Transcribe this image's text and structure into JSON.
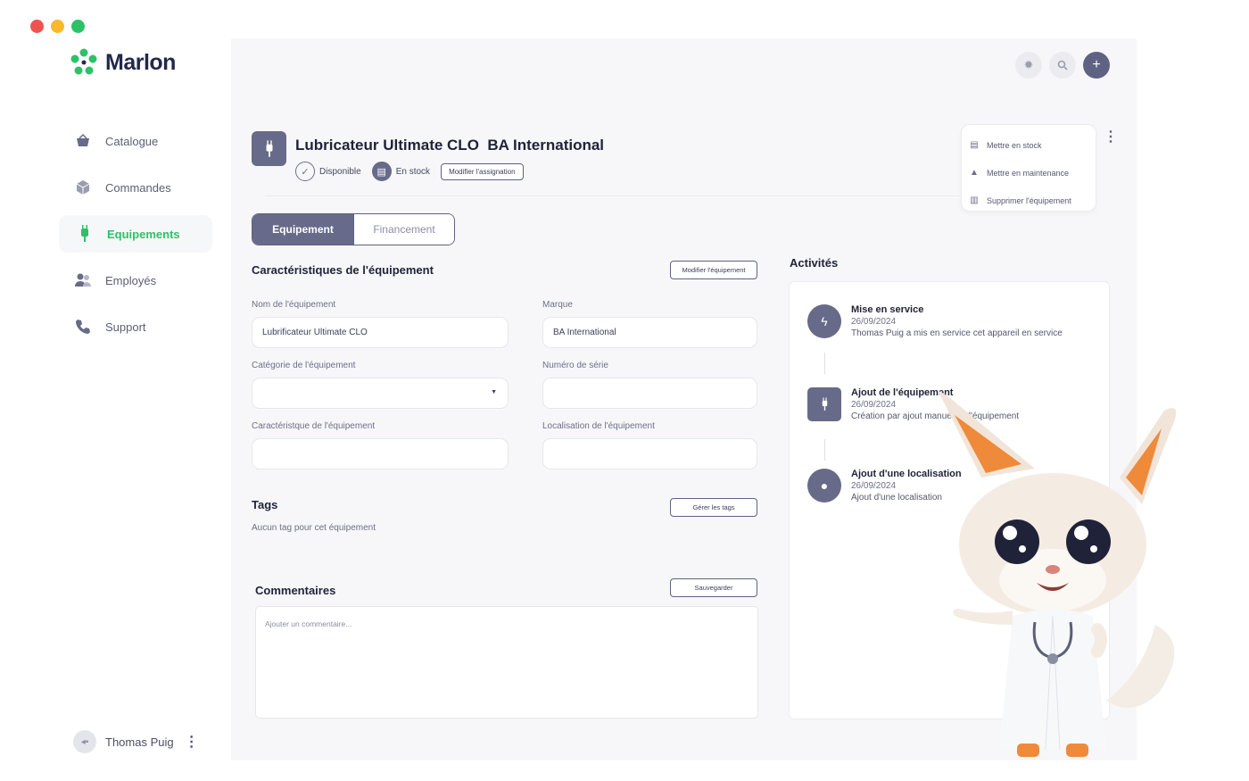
{
  "window_dots": [
    "#ef5350",
    "#fbb829",
    "#2ec16a"
  ],
  "app": {
    "name": "Marlon"
  },
  "sidebar": {
    "items": [
      {
        "label": "Catalogue",
        "icon": "basket-icon",
        "active": false
      },
      {
        "label": "Commandes",
        "icon": "box-icon",
        "active": false
      },
      {
        "label": "Equipements",
        "icon": "plug-icon",
        "active": true
      },
      {
        "label": "Employés",
        "icon": "people-icon",
        "active": false
      },
      {
        "label": "Support",
        "icon": "phone-icon",
        "active": false
      }
    ],
    "user": {
      "name": "Thomas Puig"
    }
  },
  "colors": {
    "accent": "#2ec16a",
    "primary": "#676a88",
    "background": "#f7f7f9"
  },
  "equipment": {
    "title": "Lubricateur Ultimate CLO  BA International",
    "status_available": "Disponible",
    "status_stock": "En stock",
    "modify_assignment": "Modifier l'assignation"
  },
  "actions_menu": {
    "items": [
      {
        "label": "Mettre en stock",
        "icon": "stock-icon"
      },
      {
        "label": "Mettre en maintenance",
        "icon": "warning-icon"
      },
      {
        "label": "Supprimer l'équipement",
        "icon": "trash-icon"
      }
    ]
  },
  "tabs": [
    "Equipement",
    "Financement"
  ],
  "characteristics": {
    "title": "Caractéristiques de l'équipement",
    "modify_button": "Modifier l'équipement",
    "fields": {
      "name_label": "Nom de l'équipement",
      "name_value": "Lubrificateur Ultimate CLO",
      "brand_label": "Marque",
      "brand_value": "BA International",
      "category_label": "Catégorie de l'équipement",
      "category_value": "",
      "serial_label": "Numéro de série",
      "serial_value": "",
      "feature_label": "Caractéristque de l'équipement",
      "feature_value": "",
      "location_label": "Localisation de l'équipement",
      "location_value": ""
    }
  },
  "tags": {
    "title": "Tags",
    "manage_button": "Gérer les tags",
    "empty_text": "Aucun tag pour cet équipement"
  },
  "comments": {
    "title": "Commentaires",
    "save_button": "Sauvegarder",
    "placeholder": "Ajouter un commentaire..."
  },
  "activities": {
    "title": "Activités",
    "items": [
      {
        "title": "Mise en service",
        "date": "26/09/2024",
        "desc": "Thomas Puig a mis en service cet appareil en service"
      },
      {
        "title": "Ajout de l'équipement",
        "date": "26/09/2024",
        "desc": "Création par ajout manuel de l'équipement"
      },
      {
        "title": "Ajout d'une localisation",
        "date": "26/09/2024",
        "desc": "Ajout d'une localisation"
      }
    ]
  }
}
